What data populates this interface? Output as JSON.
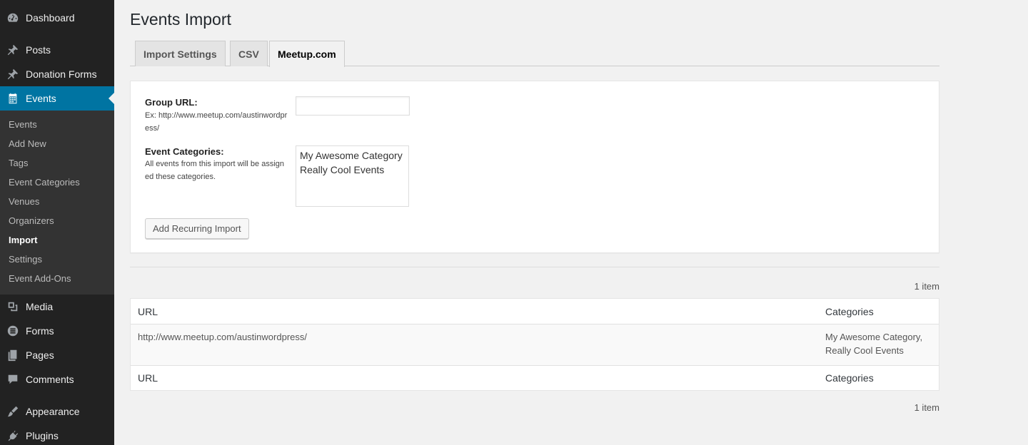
{
  "sidebar": {
    "menu": [
      {
        "label": "Dashboard",
        "icon": "dashboard-icon"
      },
      {
        "label": "Posts",
        "icon": "pin-icon"
      },
      {
        "label": "Donation Forms",
        "icon": "pin-icon"
      },
      {
        "label": "Events",
        "icon": "calendar-icon",
        "current": true
      },
      {
        "label": "Media",
        "icon": "media-icon"
      },
      {
        "label": "Forms",
        "icon": "forms-icon"
      },
      {
        "label": "Pages",
        "icon": "pages-icon"
      },
      {
        "label": "Comments",
        "icon": "comment-icon"
      },
      {
        "label": "Appearance",
        "icon": "brush-icon"
      },
      {
        "label": "Plugins",
        "icon": "plug-icon"
      }
    ],
    "submenu": [
      "Events",
      "Add New",
      "Tags",
      "Event Categories",
      "Venues",
      "Organizers",
      "Import",
      "Settings",
      "Event Add-Ons"
    ],
    "active_submenu": "Import",
    "accent_color": "#0074a2"
  },
  "page": {
    "title": "Events Import",
    "tabs": [
      "Import Settings",
      "CSV",
      "Meetup.com"
    ],
    "active_tab": "Meetup.com"
  },
  "form": {
    "group_url_label": "Group URL:",
    "group_url_desc": "Ex: http://www.meetup.com/austinwordpress/",
    "group_url_value": "",
    "categories_label": "Event Categories:",
    "categories_desc": "All events from this import will be assigned these categories.",
    "categories_options": [
      "My Awesome Category",
      "Really Cool Events"
    ],
    "submit_label": "Add Recurring Import"
  },
  "table": {
    "count_top": "1 item",
    "count_bottom": "1 item",
    "columns": [
      "URL",
      "Categories"
    ],
    "rows": [
      {
        "url": "http://www.meetup.com/austinwordpress/",
        "categories_line1": "My Awesome Category,",
        "categories_line2": "Really Cool Events"
      }
    ]
  }
}
